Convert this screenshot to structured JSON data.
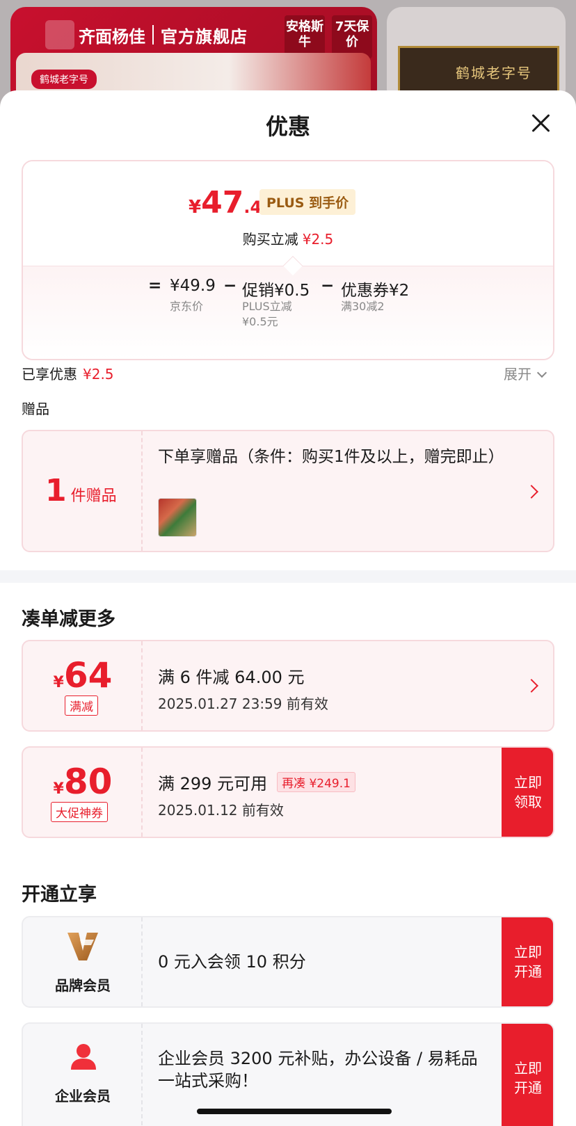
{
  "background": {
    "brand": "齐面杨佳",
    "store": "官方旗舰店",
    "tags": [
      "安格斯牛",
      "7天保价"
    ],
    "heritage_badge": "鹤城老字号",
    "plaque_text": "鹤城老字号"
  },
  "sheet": {
    "title": "优惠"
  },
  "price": {
    "yen": "¥",
    "int": "47",
    "dec": ".4",
    "plus_badge": "PLUS 到手价",
    "instant_off_label": "购买立减",
    "instant_off_value": "¥2.5"
  },
  "formula": {
    "eq": "=",
    "jd_price": "¥49.9",
    "minus1": "−",
    "promo": "促销¥0.5",
    "minus2": "−",
    "coupon": "优惠券¥2",
    "jd_label": "京东价",
    "promo_sub1": "PLUS立减",
    "promo_sub2": "¥0.5元",
    "coupon_sub": "满30减2"
  },
  "enjoyed": {
    "label": "已享优惠",
    "value": "¥2.5",
    "expand": "展开"
  },
  "gift": {
    "section_label": "赠品",
    "count": "1",
    "unit": "件赠品",
    "desc": "下单享赠品（条件：购买1件及以上，赠完即止）"
  },
  "bundle": {
    "title": "凑单减更多",
    "coupons": [
      {
        "yen": "¥",
        "value": "64",
        "tag": "满减",
        "title": "满 6 件减 64.00 元",
        "date": "2025.01.27 23:59 前有效"
      },
      {
        "yen": "¥",
        "value": "80",
        "tag": "大促神券",
        "title": "满 299 元可用",
        "need_more": "再凑 ¥249.1",
        "date": "2025.01.12 前有效",
        "action": "立即领取"
      }
    ]
  },
  "membership": {
    "title": "开通立享",
    "items": [
      {
        "name": "品牌会员",
        "desc": "0 元入会领 10 积分",
        "action": "立即开通"
      },
      {
        "name": "企业会员",
        "desc": "企业会员 3200 元补贴，办公设备 / 易耗品一站式采购！",
        "action": "立即开通"
      }
    ]
  },
  "colors": {
    "accent": "#e81e2c",
    "plus_gold": "#9a5b12"
  }
}
